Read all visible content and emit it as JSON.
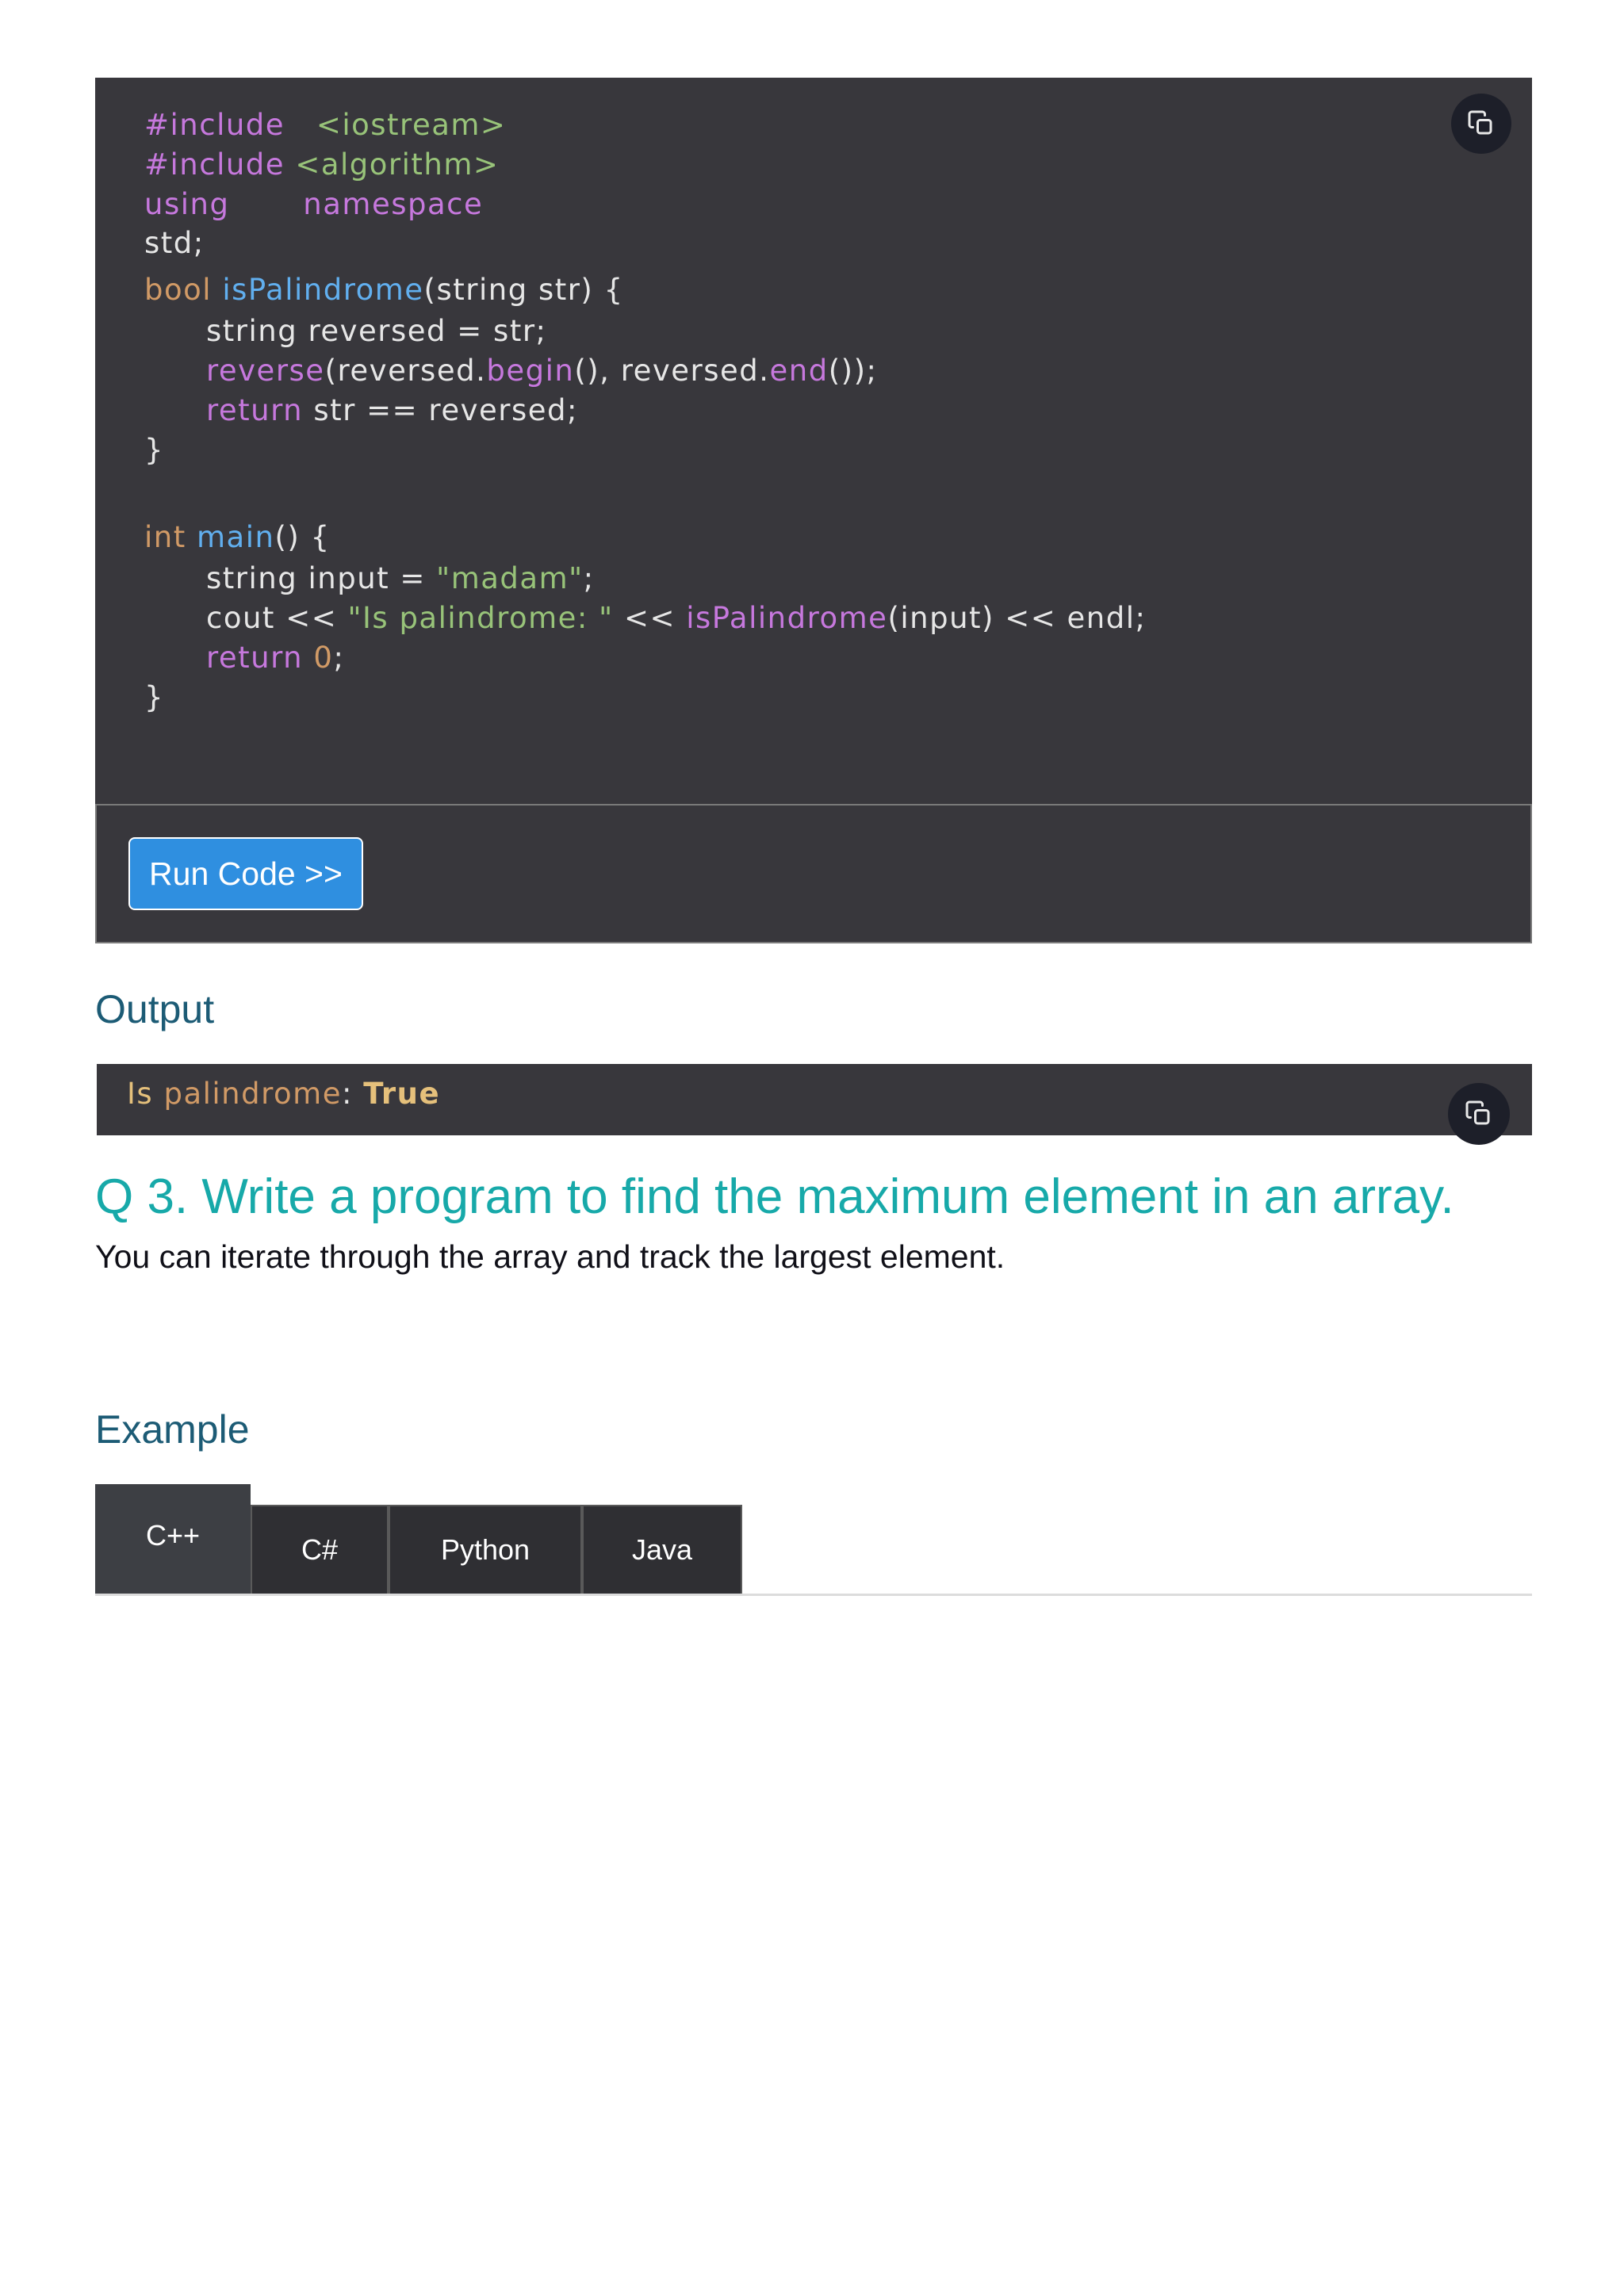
{
  "code": {
    "lines": [
      {
        "indent": false,
        "parts": [
          {
            "t": "#include",
            "c": "kw"
          },
          {
            "t": "   <iostream>",
            "c": "str"
          }
        ]
      },
      {
        "indent": false,
        "parts": [
          {
            "t": "#include",
            "c": "kw"
          },
          {
            "t": " <algorithm>",
            "c": "str"
          }
        ]
      },
      {
        "indent": false,
        "parts": [
          {
            "t": "using",
            "c": "kw"
          },
          {
            "t": "       namespace",
            "c": "kw"
          }
        ]
      },
      {
        "indent": false,
        "parts": [
          {
            "t": "std;",
            "c": "plain"
          }
        ]
      },
      {
        "indent": false,
        "parts": [
          {
            "t": "bool",
            "c": "type"
          },
          {
            "t": " ",
            "c": "plain"
          },
          {
            "t": "isPalindrome",
            "c": "fn"
          },
          {
            "t": "(string str) {",
            "c": "plain"
          }
        ]
      },
      {
        "indent": true,
        "parts": [
          {
            "t": "string reversed = str;",
            "c": "plain"
          }
        ]
      },
      {
        "indent": true,
        "parts": [
          {
            "t": "reverse",
            "c": "kw"
          },
          {
            "t": "(reversed.",
            "c": "plain"
          },
          {
            "t": "begin",
            "c": "kw"
          },
          {
            "t": "(), reversed.",
            "c": "plain"
          },
          {
            "t": "end",
            "c": "kw"
          },
          {
            "t": "());",
            "c": "plain"
          }
        ]
      },
      {
        "indent": true,
        "parts": [
          {
            "t": "return",
            "c": "kw"
          },
          {
            "t": " str == reversed;",
            "c": "plain"
          }
        ]
      },
      {
        "indent": false,
        "parts": [
          {
            "t": "}",
            "c": "plain"
          }
        ]
      },
      {
        "indent": false,
        "parts": [
          {
            "t": "int",
            "c": "type"
          },
          {
            "t": " ",
            "c": "plain"
          },
          {
            "t": "main",
            "c": "fn"
          },
          {
            "t": "() {",
            "c": "plain"
          }
        ]
      },
      {
        "indent": true,
        "parts": [
          {
            "t": "string input = ",
            "c": "plain"
          },
          {
            "t": "\"madam\"",
            "c": "str"
          },
          {
            "t": ";",
            "c": "plain"
          }
        ]
      },
      {
        "indent": true,
        "parts": [
          {
            "t": "cout << ",
            "c": "plain"
          },
          {
            "t": "\"Is palindrome: \"",
            "c": "str"
          },
          {
            "t": " << ",
            "c": "plain"
          },
          {
            "t": "isPalindrome",
            "c": "kw"
          },
          {
            "t": "(input) << endl;",
            "c": "plain"
          }
        ]
      },
      {
        "indent": true,
        "parts": [
          {
            "t": "return",
            "c": "kw"
          },
          {
            "t": " ",
            "c": "plain"
          },
          {
            "t": "0",
            "c": "num"
          },
          {
            "t": ";",
            "c": "plain"
          }
        ]
      },
      {
        "indent": false,
        "parts": [
          {
            "t": "}",
            "c": "plain"
          }
        ]
      }
    ]
  },
  "run_button_label": "Run Code >>",
  "output_heading": "Output",
  "output": {
    "is": "Is",
    "palindrome": " palindrome",
    "colon": ": ",
    "value": "True"
  },
  "question": {
    "title": "Q 3. Write a program to find the maximum element in an array.",
    "description": "You can iterate through the array and track the largest element."
  },
  "example_heading": "Example",
  "tabs": [
    {
      "label": "C++",
      "active": true
    },
    {
      "label": "C#",
      "active": false
    },
    {
      "label": "Python",
      "active": false
    },
    {
      "label": "Java",
      "active": false
    }
  ],
  "icons": {
    "copy": "copy-icon"
  },
  "colors": {
    "code_bg": "#38373c",
    "accent_teal": "#17a9a9",
    "heading_blue": "#1c5b75",
    "run_button": "#2f8fe0"
  }
}
